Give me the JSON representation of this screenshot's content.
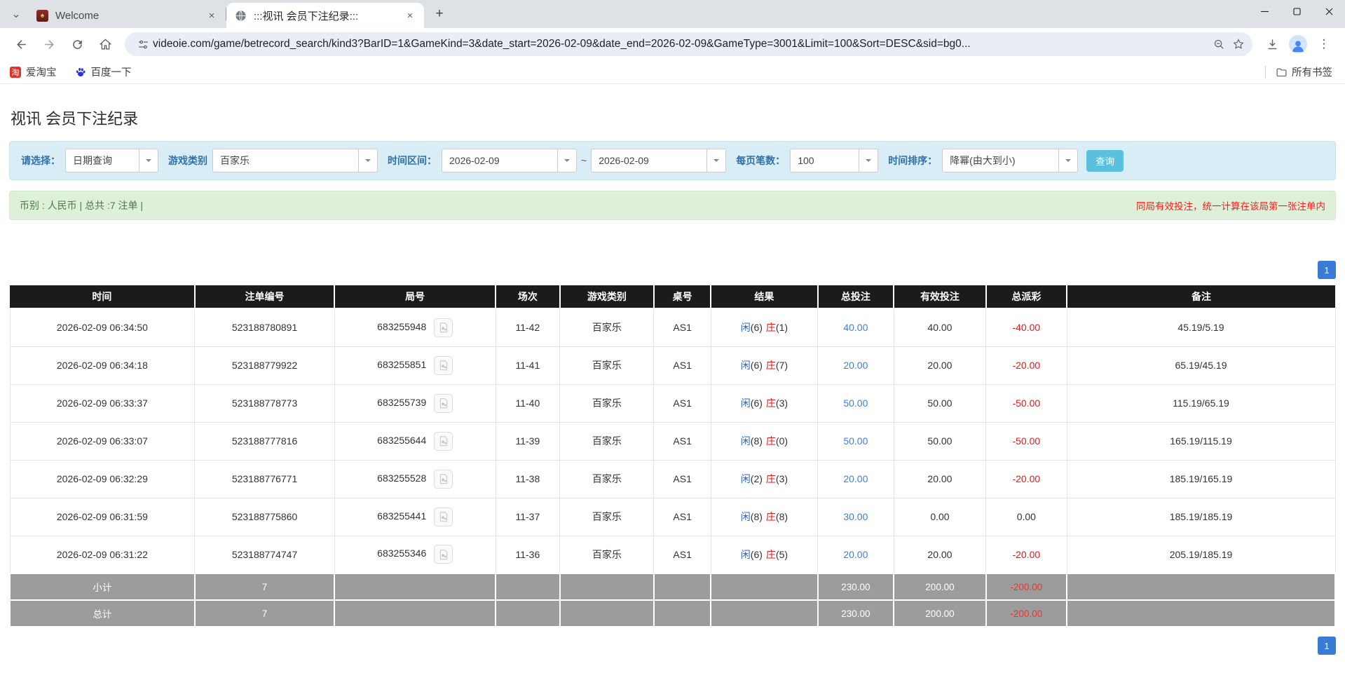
{
  "icons": {
    "chevron_down": "⌄",
    "close": "✕",
    "tab_close": "×",
    "new_tab": "+",
    "minimize": "—",
    "maximize": "☐",
    "menu_dots": "⋮",
    "tilde": "~"
  },
  "colors": {
    "filter_bg": "#d9edf7",
    "filter_label_blue": "#3071a9",
    "search_button_cyan": "#5bc0de",
    "summary_green_bg": "#dff0d8",
    "warning_red": "#fd1c1c",
    "table_header_black": "#1b1b1b",
    "footer_gray": "#9c9c9c",
    "player_blue": "#2464d2",
    "banker_red": "#e01a1a",
    "bet_link_blue": "#3d7fd6",
    "pager_blue": "#3a7bd5"
  },
  "browser": {
    "tabs": [
      {
        "title": "Welcome"
      },
      {
        "title": ":::视讯 会员下注纪录:::"
      }
    ],
    "url": "videoie.com/game/betrecord_search/kind3?BarID=1&GameKind=3&date_start=2026-02-09&date_end=2026-02-09&GameType=3001&Limit=100&Sort=DESC&sid=bg0...",
    "bookmarks": [
      {
        "label": "爱淘宝",
        "icon": "taobao-icon",
        "icon_glyph": "淘"
      },
      {
        "label": "百度一下",
        "icon": "baidu-paw-icon"
      }
    ],
    "all_bookmarks_label": "所有书签"
  },
  "page": {
    "title": "视讯 会员下注纪录",
    "filters": {
      "select_label": "请选择：",
      "select_value": "日期查询",
      "game_kind_label": "游戏类别",
      "game_kind_value": "百家乐",
      "date_range_label": "时间区间：",
      "date_start": "2026-02-09",
      "date_end": "2026-02-09",
      "per_page_label": "每页笔数：",
      "per_page_value": "100",
      "sort_label": "时间排序：",
      "sort_value": "降幂(由大到小)",
      "search_button": "查询"
    },
    "summary": {
      "left": "币别 : 人民币 | 总共 :7 注单 |",
      "right": "同局有效投注，统一计算在该局第一张注单内"
    },
    "pagination": {
      "page": "1"
    },
    "table": {
      "headers": [
        "时间",
        "注单编号",
        "局号",
        "场次",
        "游戏类别",
        "桌号",
        "结果",
        "总投注",
        "有效投注",
        "总派彩",
        "备注"
      ],
      "rows": [
        {
          "time": "2026-02-09 06:34:50",
          "bet_id": "523188780891",
          "round": "683255948",
          "session": "11-42",
          "game": "百家乐",
          "table_no": "AS1",
          "player_label": "闲",
          "player_num": "(6)",
          "banker_label": "庄",
          "banker_num": "(1)",
          "total_bet": "40.00",
          "valid_bet": "40.00",
          "payout": "-40.00",
          "remark": "45.19/5.19"
        },
        {
          "time": "2026-02-09 06:34:18",
          "bet_id": "523188779922",
          "round": "683255851",
          "session": "11-41",
          "game": "百家乐",
          "table_no": "AS1",
          "player_label": "闲",
          "player_num": "(6)",
          "banker_label": "庄",
          "banker_num": "(7)",
          "total_bet": "20.00",
          "valid_bet": "20.00",
          "payout": "-20.00",
          "remark": "65.19/45.19"
        },
        {
          "time": "2026-02-09 06:33:37",
          "bet_id": "523188778773",
          "round": "683255739",
          "session": "11-40",
          "game": "百家乐",
          "table_no": "AS1",
          "player_label": "闲",
          "player_num": "(6)",
          "banker_label": "庄",
          "banker_num": "(3)",
          "total_bet": "50.00",
          "valid_bet": "50.00",
          "payout": "-50.00",
          "remark": "115.19/65.19"
        },
        {
          "time": "2026-02-09 06:33:07",
          "bet_id": "523188777816",
          "round": "683255644",
          "session": "11-39",
          "game": "百家乐",
          "table_no": "AS1",
          "player_label": "闲",
          "player_num": "(8)",
          "banker_label": "庄",
          "banker_num": "(0)",
          "total_bet": "50.00",
          "valid_bet": "50.00",
          "payout": "-50.00",
          "remark": "165.19/115.19"
        },
        {
          "time": "2026-02-09 06:32:29",
          "bet_id": "523188776771",
          "round": "683255528",
          "session": "11-38",
          "game": "百家乐",
          "table_no": "AS1",
          "player_label": "闲",
          "player_num": "(2)",
          "banker_label": "庄",
          "banker_num": "(3)",
          "total_bet": "20.00",
          "valid_bet": "20.00",
          "payout": "-20.00",
          "remark": "185.19/165.19"
        },
        {
          "time": "2026-02-09 06:31:59",
          "bet_id": "523188775860",
          "round": "683255441",
          "session": "11-37",
          "game": "百家乐",
          "table_no": "AS1",
          "player_label": "闲",
          "player_num": "(8)",
          "banker_label": "庄",
          "banker_num": "(8)",
          "total_bet": "30.00",
          "valid_bet": "0.00",
          "payout": "0.00",
          "remark": "185.19/185.19"
        },
        {
          "time": "2026-02-09 06:31:22",
          "bet_id": "523188774747",
          "round": "683255346",
          "session": "11-36",
          "game": "百家乐",
          "table_no": "AS1",
          "player_label": "闲",
          "player_num": "(6)",
          "banker_label": "庄",
          "banker_num": "(5)",
          "total_bet": "20.00",
          "valid_bet": "20.00",
          "payout": "-20.00",
          "remark": "205.19/185.19"
        }
      ],
      "subtotal": {
        "label": "小计",
        "count": "7",
        "total_bet": "230.00",
        "valid_bet": "200.00",
        "payout": "-200.00"
      },
      "total": {
        "label": "总计",
        "count": "7",
        "total_bet": "230.00",
        "valid_bet": "200.00",
        "payout": "-200.00"
      }
    }
  }
}
